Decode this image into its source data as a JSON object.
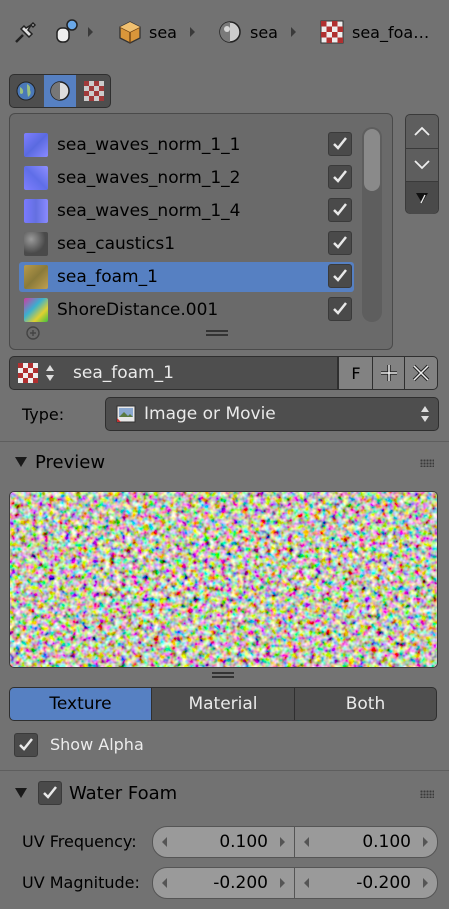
{
  "breadcrumb": {
    "items": [
      {
        "label": "sea",
        "icon": "cube-icon"
      },
      {
        "label": "sea",
        "icon": "material-sphere-icon"
      },
      {
        "label": "sea_foa…",
        "icon": "checker-texture-icon"
      }
    ]
  },
  "context_tabs": [
    "world-icon",
    "material-sphere-icon",
    "checker-texture-icon"
  ],
  "texture_slots": [
    {
      "label": "sea_waves_norm_1_1",
      "checked": true
    },
    {
      "label": "sea_waves_norm_1_2",
      "checked": true
    },
    {
      "label": "sea_waves_norm_1_4",
      "checked": true
    },
    {
      "label": "sea_caustics1",
      "checked": true
    },
    {
      "label": "sea_foam_1",
      "checked": true,
      "selected": true
    },
    {
      "label": "ShoreDistance.001",
      "checked": true
    }
  ],
  "texture": {
    "name": "sea_foam_1",
    "fake_user_label": "F"
  },
  "type": {
    "label": "Type:",
    "value": "Image or Movie"
  },
  "preview": {
    "title": "Preview",
    "modes": [
      "Texture",
      "Material",
      "Both"
    ],
    "active_mode": "Texture",
    "show_alpha_label": "Show Alpha",
    "show_alpha": true
  },
  "water_foam": {
    "title": "Water Foam",
    "enabled": true,
    "uv_frequency_label": "UV Frequency:",
    "uv_frequency": [
      "0.100",
      "0.100"
    ],
    "uv_magnitude_label": "UV Magnitude:",
    "uv_magnitude": [
      "-0.200",
      "-0.200"
    ]
  },
  "colors": {
    "background": "#727272",
    "accent": "#5680c2",
    "field": "#4e4e4e"
  }
}
